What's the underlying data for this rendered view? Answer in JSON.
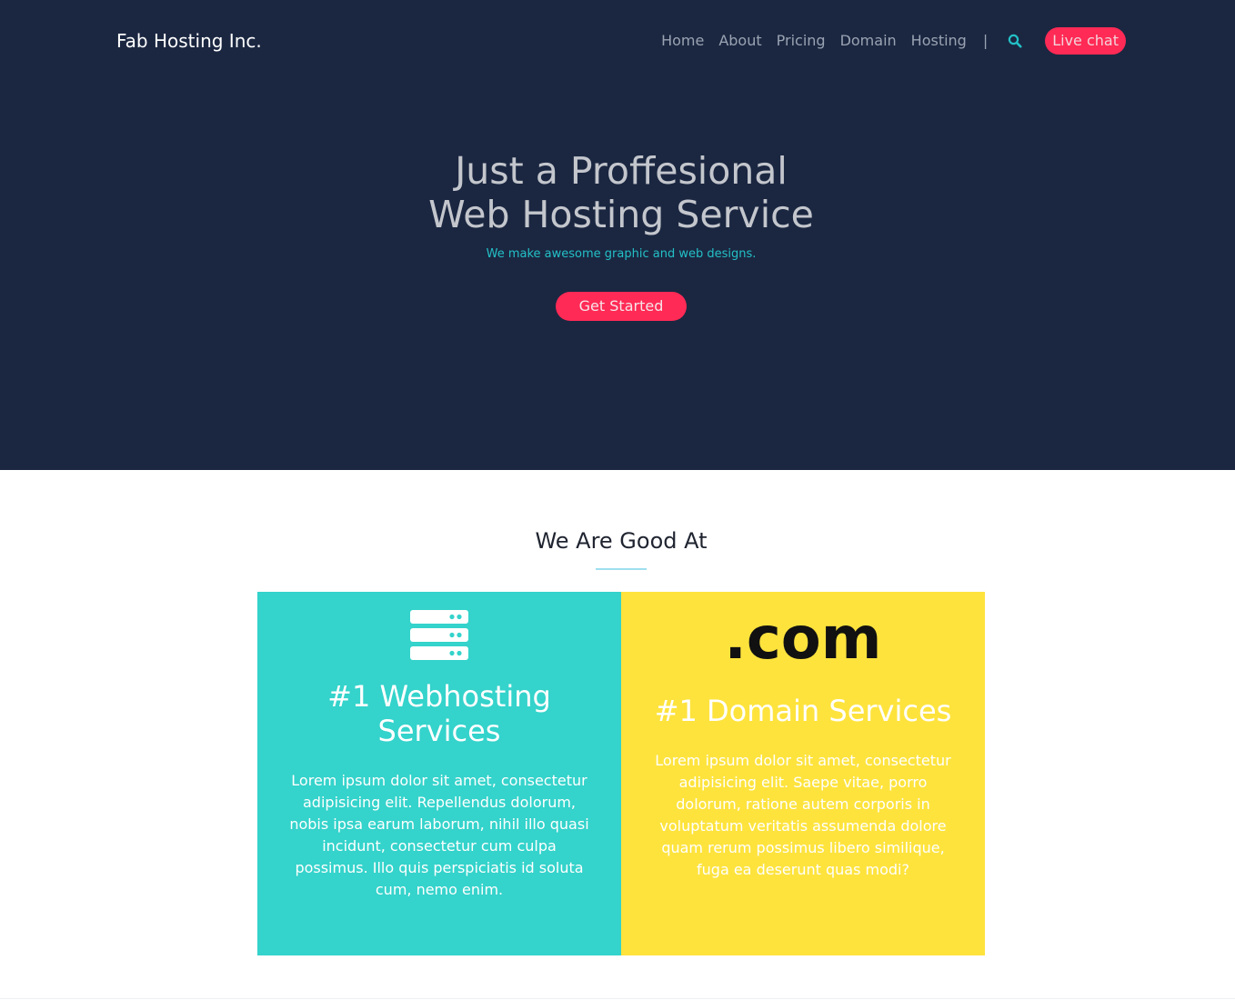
{
  "header": {
    "brand": "Fab Hosting Inc.",
    "nav": [
      "Home",
      "About",
      "Pricing",
      "Domain",
      "Hosting"
    ],
    "separator": "|",
    "search_icon": "search-icon",
    "live_chat": "Live chat"
  },
  "hero": {
    "title_line1": "Just a Proffesional",
    "title_line2": "Web Hosting Service",
    "subtitle": "We make awesome graphic and web designs.",
    "cta": "Get Started"
  },
  "services": {
    "title": "We Are Good At",
    "cards": [
      {
        "icon": "server-icon",
        "heading_line1": "#1 Webhosting",
        "heading_line2": "Services",
        "body": "Lorem ipsum dolor sit amet, consectetur adipisicing elit. Repellendus dolorum, nobis ipsa earum laborum, nihil illo quasi incidunt, consectetur cum culpa possimus. Illo quis perspiciatis id soluta cum, nemo enim.",
        "color": "#34d3cb"
      },
      {
        "icon_text": ".com",
        "heading": "#1 Domain Services",
        "body": "Lorem ipsum dolor sit amet, consectetur adipisicing elit. Saepe vitae, porro dolorum, ratione autem corporis in voluptatum veritatis assumenda dolore quam rerum possimus libero similique, fuga ea deserunt quas modi?",
        "color": "#fee33d"
      }
    ]
  },
  "colors": {
    "hero_bg": "#1b2741",
    "accent_pink": "#ff2a55",
    "accent_teal": "#23c0c6"
  }
}
